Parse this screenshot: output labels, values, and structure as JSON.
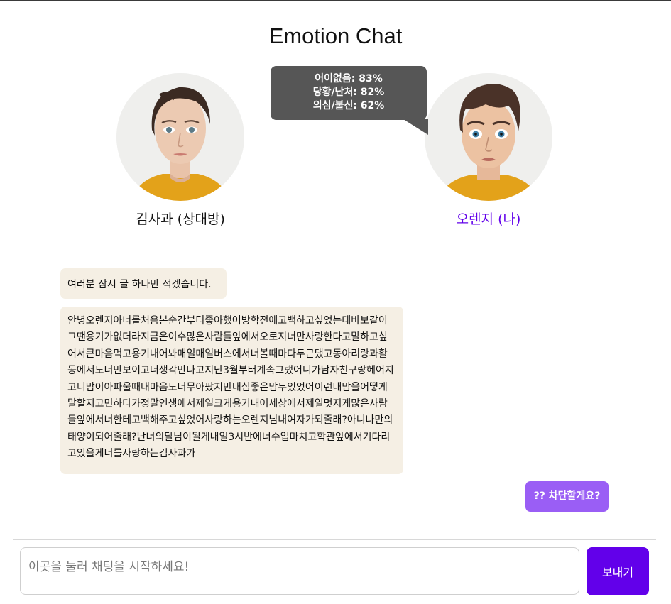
{
  "app": {
    "title": "Emotion Chat"
  },
  "participants": {
    "other": {
      "name": "김사과 (상대방)",
      "avatar_icon": "female-portrait-avatar"
    },
    "me": {
      "name": "오렌지 (나)",
      "name_color": "#6200ea",
      "avatar_icon": "male-surprised-portrait-avatar"
    }
  },
  "emotion_tooltip": {
    "lines": [
      "어이없음: 83%",
      "당황/난처: 82%",
      "의심/불신: 62%"
    ]
  },
  "messages": [
    {
      "from": "other",
      "text": "여러분 잠시 글 하나만 적겠습니다."
    },
    {
      "from": "other",
      "text": "안녕오렌지아너를처음본순간부터좋아했어방학전에고백하고싶었는데바보같이그땐용기가없더라지금은이수많은사람들앞에서오로지너만사랑한다고말하고싶어서큰마음먹고용기내어봐매일매일버스에서너볼때마다두근댔고동아리랑과활동에서도너만보이고너생각만나고지난3월부터계속그랬어니가남자친구랑헤어지고니맘이아파울때내마음도너무아팠지만내심좋은맘두있었어이런내맘을어떻게말할지고민하다가정말인생에서제일크게용기내어세상에서제일멋지게많은사람들앞에서너한테고백해주고싶었어사랑하는오렌지님내여자가되줄래?아니나만의태양이되어줄래?난너의달님이될게내일3시반에너수업마치고학관앞에서기다리고있을게너를사랑하는김사과가"
    },
    {
      "from": "me",
      "text": "?? 차단할게요?"
    }
  ],
  "composer": {
    "placeholder": "이곳을 눌러 채팅을 시작하세요!",
    "value": "",
    "send_label": "보내기"
  },
  "colors": {
    "other_bubble": "#f5efe4",
    "me_bubble": "#9a5ef5",
    "send_button": "#6200ea",
    "tooltip": "#565656"
  }
}
